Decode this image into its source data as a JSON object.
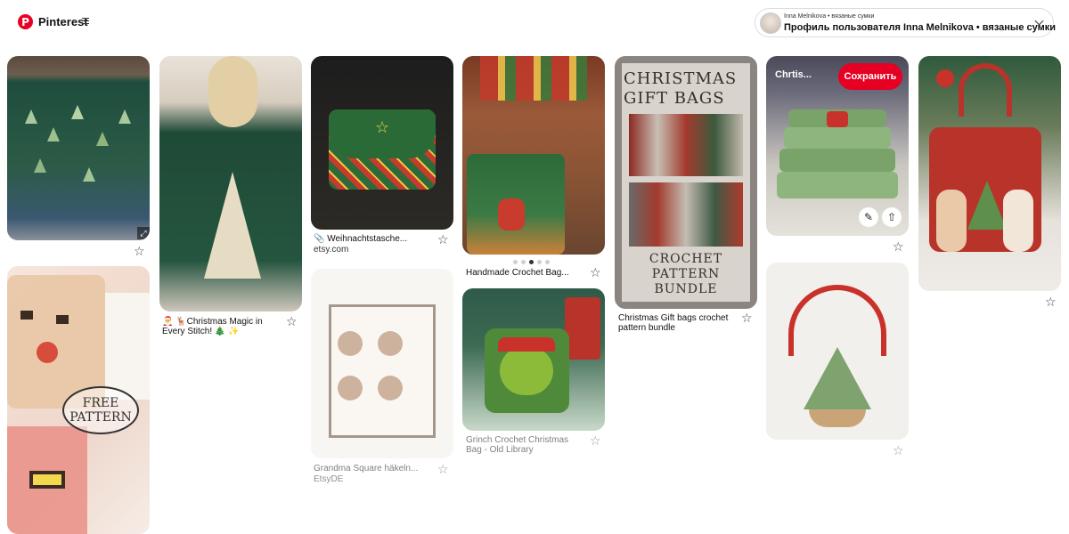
{
  "header": {
    "logo_text": "Pinterest",
    "profile_subtitle": "Inna Melnikova • вязаные сумки",
    "profile_title": "Профиль пользователя Inna Melnikova • вязаные сумки"
  },
  "pins": {
    "p1": {
      "image": "christmas-tree-sweater"
    },
    "p2": {
      "image": "free-pattern-bags",
      "badge": "FREE\nPATTERN"
    },
    "p3": {
      "image": "tree-sweater-woman",
      "title": "🎅 🦌Christmas Magic in Every Stitch! 🎄 ✨"
    },
    "p4": {
      "image": "plaid-crochet-bag",
      "title": "📎 Weihnachtstasche...",
      "source": "etsy.com"
    },
    "p5": {
      "image": "reindeer-granny-bag",
      "title": "Grandma Square häkeln...",
      "source": "EtsyDE"
    },
    "p6": {
      "image": "handmade-crochet-bag",
      "title": "Handmade Crochet Bag..."
    },
    "p7": {
      "image": "grinch-bag",
      "title": "Grinch Crochet Christmas Bag - Old Library"
    },
    "p8": {
      "image": "gift-bags-bundle",
      "title": "Christmas Gift bags crochet pattern bundle",
      "img_title": "CHRISTMAS GIFT BAGS",
      "img_footer": "CROCHET PATTERN BUNDLE"
    },
    "p9": {
      "image": "tree-tiered-bag",
      "board_chip": "Chrtis...",
      "save_label": "Сохранить"
    },
    "p10": {
      "image": "green-tree-purse"
    },
    "p11": {
      "image": "red-tote-with-dolls"
    }
  },
  "icons": {
    "star": "star-icon",
    "pin": "pin-icon",
    "share": "share-icon",
    "edit": "pencil-icon"
  },
  "colors": {
    "brand": "#e60023"
  }
}
